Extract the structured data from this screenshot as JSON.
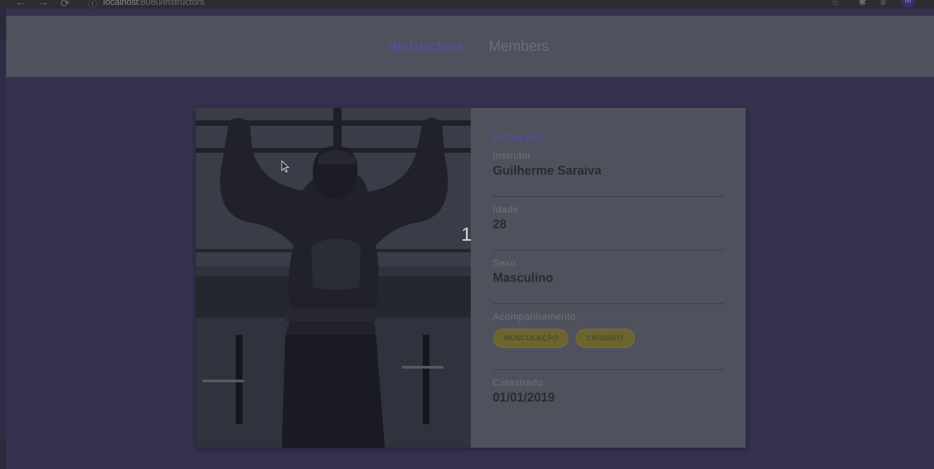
{
  "browser": {
    "back_icon": "←",
    "forward_icon": "→",
    "reload_icon": "⟳",
    "info_icon": "ⓘ",
    "url_host": "localhost",
    "url_path": ":8080/instructors",
    "star_icon": "☆",
    "extensions_icon": "✱",
    "media_icon": "≡",
    "profile_initial": "M"
  },
  "nav": {
    "instructors": "Instructors",
    "members": "Members"
  },
  "slider": {
    "number": "1"
  },
  "details": {
    "heading": "DETALHES",
    "instructor_label": "Instrutor",
    "instructor_value": "Guilherme Saraiva",
    "age_label": "Idade",
    "age_value": "28",
    "sex_label": "Sexo",
    "sex_value": "Masculino",
    "services_label": "Acompanhamento",
    "services": [
      "MUSCULAÇÃO",
      "CROSSFIT"
    ],
    "created_label": "Catastrado",
    "created_value": "01/01/2019"
  },
  "colors": {
    "accent": "#5a4c9a",
    "background": "#35314e",
    "tag": "#6d6530"
  }
}
